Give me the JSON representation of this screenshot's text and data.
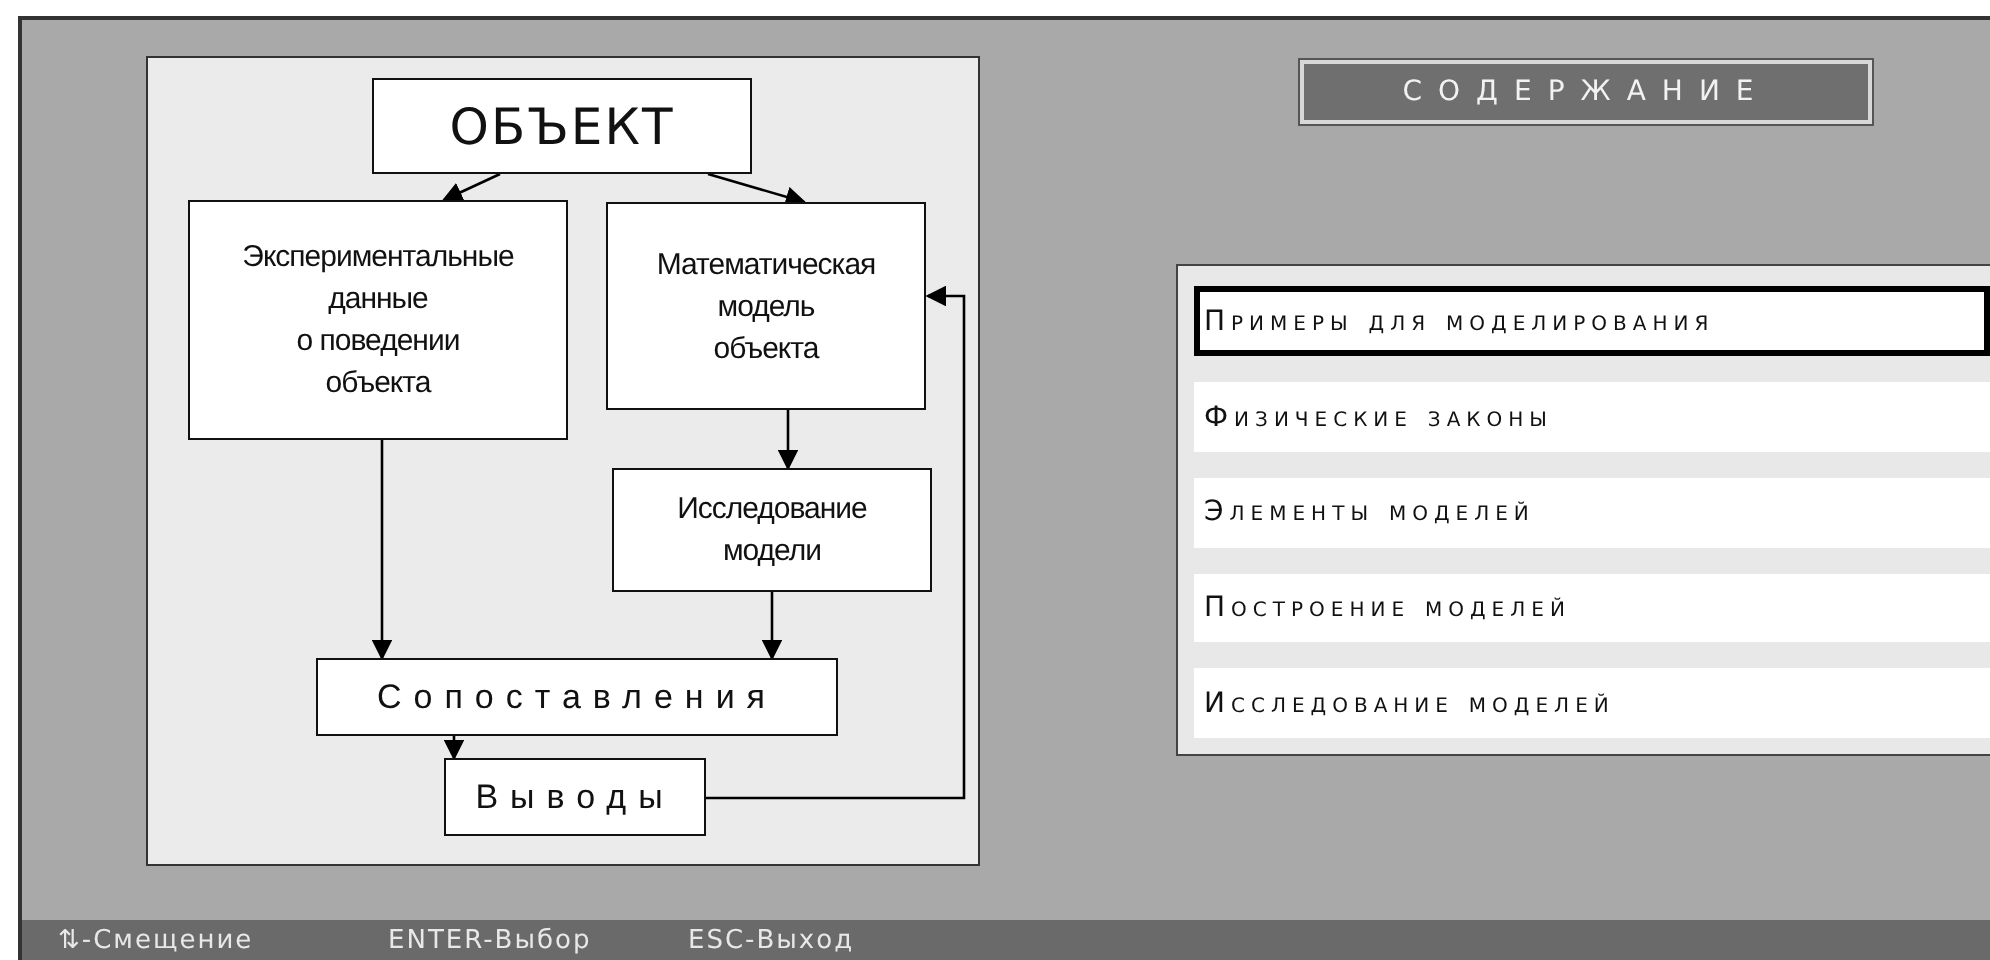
{
  "diagram": {
    "nodes": [
      {
        "lines": [
          "ОБЪЕКТ"
        ]
      },
      {
        "lines": [
          "Экспериментальные",
          "данные",
          "о поведении",
          "объекта"
        ]
      },
      {
        "lines": [
          "Математическая",
          "модель",
          "объекта"
        ]
      },
      {
        "lines": [
          "Исследование",
          "модели"
        ]
      },
      {
        "lines": [
          "Сопоставления"
        ]
      },
      {
        "lines": [
          "Выводы"
        ]
      }
    ]
  },
  "contents": {
    "title": "СОДЕРЖАНИЕ",
    "items": [
      {
        "label": "Примеры для моделирования",
        "selected": true
      },
      {
        "label": "Физические законы",
        "selected": false
      },
      {
        "label": "Элементы моделей",
        "selected": false
      },
      {
        "label": "Построение моделей",
        "selected": false
      },
      {
        "label": "Исследование моделей",
        "selected": false
      }
    ]
  },
  "status_bar": [
    {
      "text": "⇅-Смещение"
    },
    {
      "text": "ENTER-Выбор"
    },
    {
      "text": "ESC-Выход"
    }
  ]
}
